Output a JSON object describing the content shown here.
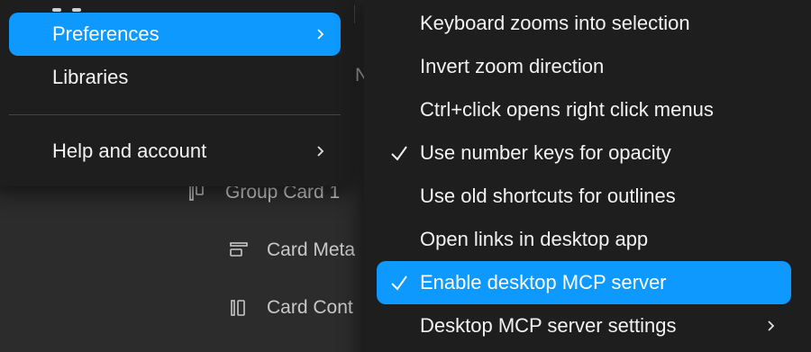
{
  "colors": {
    "highlight": "#0d99ff",
    "menu_bg": "#1e1e1e",
    "panel_bg": "#2c2c2c"
  },
  "layers": {
    "stray_char": "N",
    "rows": [
      {
        "label": "Group Card 1",
        "icon": "layout-columns-icon"
      },
      {
        "label": "Card Meta",
        "icon": "layout-rows-icon"
      },
      {
        "label": "Card Cont",
        "icon": "layout-columns-icon"
      }
    ]
  },
  "main_menu": {
    "items": [
      {
        "label": "Preferences",
        "has_submenu": true,
        "active": true
      },
      {
        "label": "Libraries",
        "has_submenu": false,
        "active": false
      },
      {
        "label": "Help and account",
        "has_submenu": true,
        "active": false
      }
    ]
  },
  "preferences_menu": {
    "items": [
      {
        "label": "Keyboard zooms into selection",
        "checked": false,
        "active": false,
        "has_submenu": false
      },
      {
        "label": "Invert zoom direction",
        "checked": false,
        "active": false,
        "has_submenu": false
      },
      {
        "label": "Ctrl+click opens right click menus",
        "checked": false,
        "active": false,
        "has_submenu": false
      },
      {
        "label": "Use number keys for opacity",
        "checked": true,
        "active": false,
        "has_submenu": false
      },
      {
        "label": "Use old shortcuts for outlines",
        "checked": false,
        "active": false,
        "has_submenu": false
      },
      {
        "label": "Open links in desktop app",
        "checked": false,
        "active": false,
        "has_submenu": false
      },
      {
        "label": "Enable desktop MCP server",
        "checked": true,
        "active": true,
        "has_submenu": false
      },
      {
        "label": "Desktop MCP server settings",
        "checked": false,
        "active": false,
        "has_submenu": true
      }
    ]
  }
}
